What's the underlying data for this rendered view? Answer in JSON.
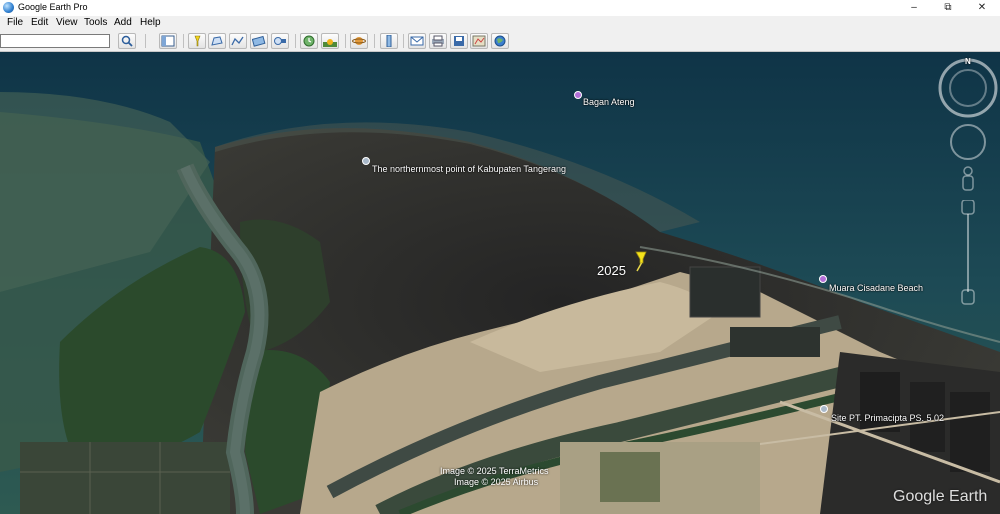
{
  "window": {
    "title": "Google Earth Pro",
    "minimize": "–",
    "restore": "⧉",
    "close": "✕"
  },
  "menu": [
    "File",
    "Edit",
    "View",
    "Tools",
    "Add",
    "Help"
  ],
  "search": {
    "value": ""
  },
  "toolbar": {
    "buttons": [
      "search-button",
      "sidebar-toggle",
      "placemark",
      "polygon",
      "path",
      "image-overlay",
      "record-tour",
      "historical-imagery",
      "sunlight",
      "planets",
      "ruler",
      "email",
      "print",
      "save-image",
      "view-in-maps",
      "sky"
    ]
  },
  "map": {
    "places": {
      "bagan_ateng": "Bagan Ateng",
      "northernmost": "The northernmost point of Kabupaten Tangerang",
      "muara": "Muara Cisadane Beach",
      "site": "Site PT. Primacipta PS. 5 02"
    },
    "pushpin_label": "2025",
    "credits": [
      "Image © 2025 TerraMetrics",
      "Image © 2025 Airbus"
    ],
    "watermark": "Google Earth",
    "compass_north": "N"
  },
  "colors": {
    "sea_deep": "#123a4e",
    "sea_shallow": "#2f5f5a",
    "mudflat": "#2d2d2a",
    "mangrove": "#2b4a2c",
    "sand": "#b7a88c",
    "pushpin": "#f4e21a",
    "place_marker": "#b36fd8"
  }
}
